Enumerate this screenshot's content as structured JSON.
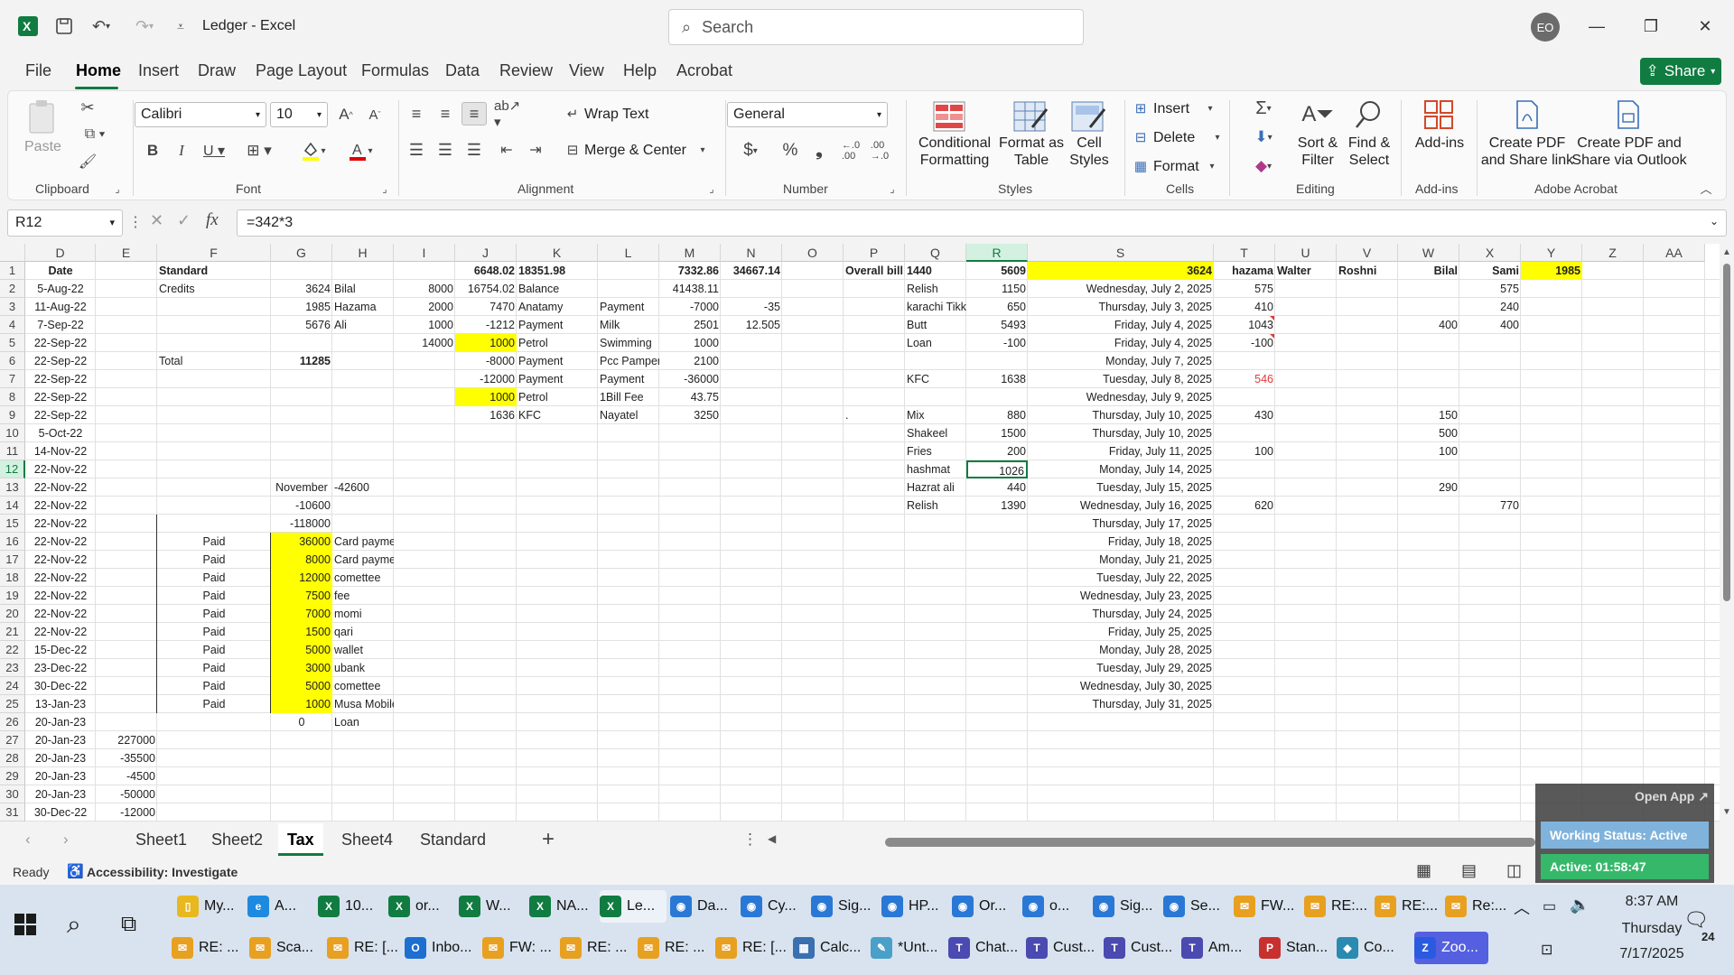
{
  "app": {
    "doc_title": "Ledger  -  Excel",
    "search_placeholder": "Search",
    "avatar_initials": "EO",
    "share_label": "Share"
  },
  "menu": [
    "File",
    "Home",
    "Insert",
    "Draw",
    "Page Layout",
    "Formulas",
    "Data",
    "Review",
    "View",
    "Help",
    "Acrobat"
  ],
  "ribbon": {
    "paste": "Paste",
    "clipboard": "Clipboard",
    "font_name": "Calibri",
    "font_size": "10",
    "font": "Font",
    "wrap_text": "Wrap Text",
    "merge_center": "Merge & Center",
    "alignment": "Alignment",
    "number_format": "General",
    "number": "Number",
    "conditional_formatting": "Conditional Formatting",
    "format_as_table": "Format as Table",
    "cell_styles": "Cell Styles",
    "styles": "Styles",
    "insert": "Insert",
    "delete": "Delete",
    "format": "Format",
    "cells": "Cells",
    "sort_filter": "Sort & Filter",
    "find_select": "Find & Select",
    "editing": "Editing",
    "add_ins": "Add-ins",
    "add_ins_group": "Add-ins",
    "create_pdf_link": "Create PDF and Share link",
    "create_pdf_outlook": "Create PDF and Share via Outlook",
    "adobe_acrobat": "Adobe Acrobat"
  },
  "formula": {
    "namebox": "R12",
    "content": "=342*3"
  },
  "columns": [
    "D",
    "E",
    "F",
    "G",
    "H",
    "I",
    "J",
    "K",
    "L",
    "M",
    "N",
    "O",
    "P",
    "Q",
    "R",
    "S",
    "T",
    "U",
    "V",
    "W",
    "X",
    "Y",
    "Z",
    "AA"
  ],
  "rows": [
    "1",
    "2",
    "3",
    "4",
    "5",
    "6",
    "7",
    "8",
    "9",
    "10",
    "11",
    "12",
    "13",
    "14",
    "15",
    "16",
    "17",
    "18",
    "19",
    "20",
    "21",
    "22",
    "23",
    "24",
    "25",
    "26",
    "27",
    "28",
    "29",
    "30",
    "31"
  ],
  "cells": {
    "D": [
      "Date",
      "5-Aug-22",
      "11-Aug-22",
      "7-Sep-22",
      "22-Sep-22",
      "22-Sep-22",
      "22-Sep-22",
      "22-Sep-22",
      "22-Sep-22",
      "5-Oct-22",
      "14-Nov-22",
      "22-Nov-22",
      "22-Nov-22",
      "22-Nov-22",
      "22-Nov-22",
      "22-Nov-22",
      "22-Nov-22",
      "22-Nov-22",
      "22-Nov-22",
      "22-Nov-22",
      "22-Nov-22",
      "15-Dec-22",
      "23-Dec-22",
      "30-Dec-22",
      "13-Jan-23",
      "20-Jan-23",
      "20-Jan-23",
      "20-Jan-23",
      "20-Jan-23",
      "20-Jan-23",
      "30-Dec-22"
    ],
    "E": {
      "27": "227000",
      "28": "-35500",
      "29": "-4500",
      "30": "-50000",
      "31": "-12000"
    },
    "F": {
      "1": "Standard",
      "2": "Credits",
      "6": "Total",
      "16": "Paid",
      "17": "Paid",
      "18": "Paid",
      "19": "Paid",
      "20": "Paid",
      "21": "Paid",
      "22": "Paid",
      "23": "Paid",
      "24": "Paid",
      "25": "Paid"
    },
    "G": {
      "2": "3624",
      "3": "1985",
      "4": "5676",
      "6": "11285",
      "13": "November",
      "14": "-10600",
      "15": "-118000",
      "16": "36000",
      "17": "8000",
      "18": "12000",
      "19": "7500",
      "20": "7000",
      "21": "1500",
      "22": "5000",
      "23": "3000",
      "24": "5000",
      "25": "1000",
      "26": "0"
    },
    "H": {
      "2": "Bilal",
      "3": "Hazama",
      "4": "Ali",
      "13": "-42600",
      "16": "Card payment",
      "17": "Card payment 2",
      "18": "comettee",
      "19": "fee",
      "20": "momi",
      "21": "qari",
      "22": "wallet",
      "23": "ubank",
      "24": "comettee",
      "25": "Musa Mobile",
      "26": "Loan"
    },
    "I": {
      "2": "8000",
      "3": "2000",
      "4": "1000",
      "5": "14000"
    },
    "J": {
      "1": "6648.02",
      "2": "16754.02",
      "3": "7470",
      "4": "-1212",
      "5": "1000",
      "6": "-8000",
      "7": "-12000",
      "8": "1000",
      "9": "1636"
    },
    "K": {
      "1": "18351.98",
      "2": "Balance",
      "3": "Anatamy",
      "4": "Payment",
      "5": "Petrol",
      "6": "Payment",
      "7": "Payment",
      "8": "Petrol",
      "9": "KFC"
    },
    "L": {
      "3": "Payment",
      "4": "Milk",
      "5": "Swimming",
      "6": "Pcc Pamper",
      "7": "Payment",
      "8": "1Bill Fee",
      "9": "Nayatel"
    },
    "M": {
      "1": "7332.86",
      "2": "41438.11",
      "3": "-7000",
      "4": "2501",
      "5": "1000",
      "6": "2100",
      "7": "-36000",
      "8": "43.75",
      "9": "3250"
    },
    "N": {
      "1": "34667.14",
      "3": "-35",
      "4": "12.505"
    },
    "P": {
      "1": "Overall bill",
      "9": "."
    },
    "Q": {
      "1": "1440",
      "2": "Relish",
      "3": "karachi Tikka",
      "4": "Butt",
      "5": "Loan",
      "7": "KFC",
      "9": "Mix",
      "10": "Shakeel",
      "11": "Fries",
      "12": "hashmat",
      "13": "Hazrat ali",
      "14": "Relish"
    },
    "R": {
      "1": "5609",
      "2": "1150",
      "3": "650",
      "4": "5493",
      "5": "-100",
      "7": "1638",
      "9": "880",
      "10": "1500",
      "11": "200",
      "12": "1026",
      "13": "440",
      "14": "1390"
    },
    "S": {
      "1": "3624",
      "2": "Wednesday, July 2, 2025",
      "3": "Thursday, July 3, 2025",
      "4": "Friday, July 4, 2025",
      "5": "Friday, July 4, 2025",
      "6": "Monday, July 7, 2025",
      "7": "Tuesday, July 8, 2025",
      "8": "Wednesday, July 9, 2025",
      "9": "Thursday, July 10, 2025",
      "10": "Thursday, July 10, 2025",
      "11": "Friday, July 11, 2025",
      "12": "Monday, July 14, 2025",
      "13": "Tuesday, July 15, 2025",
      "14": "Wednesday, July 16, 2025",
      "15": "Thursday, July 17, 2025",
      "16": "Friday, July 18, 2025",
      "17": "Monday, July 21, 2025",
      "18": "Tuesday, July 22, 2025",
      "19": "Wednesday, July 23, 2025",
      "20": "Thursday, July 24, 2025",
      "21": "Friday, July 25, 2025",
      "22": "Monday, July 28, 2025",
      "23": "Tuesday, July 29, 2025",
      "24": "Wednesday, July 30, 2025",
      "25": "Thursday, July 31, 2025"
    },
    "T": {
      "1": "hazama",
      "2": "575",
      "3": "410",
      "4": "1043",
      "5": "-100",
      "7": "546",
      "9": "430",
      "11": "100",
      "14": "620"
    },
    "U": {
      "1": "Walter"
    },
    "V": {
      "1": "Roshni"
    },
    "W": {
      "1": "Bilal",
      "4": "400",
      "9": "150",
      "10": "500",
      "11": "100",
      "13": "290"
    },
    "X": {
      "1": "Sami",
      "2": "575",
      "3": "240",
      "4": "400",
      "14": "770"
    },
    "Y": {
      "1": "1985"
    }
  },
  "sheets": [
    "Sheet1",
    "Sheet2",
    "Tax",
    "Sheet4",
    "Standard"
  ],
  "status": {
    "ready": "Ready",
    "accessibility": "Accessibility: Investigate"
  },
  "overlay": {
    "open_app": "Open App ↗",
    "working_status": "Working Status: Active",
    "active_time": "Active: 01:58:47"
  },
  "taskbar": {
    "row1": [
      "My...",
      "A...",
      "10...",
      "or...",
      "W...",
      "NA...",
      "Le...",
      "Da...",
      "Cy...",
      "Sig...",
      "HP...",
      "Or...",
      "o...",
      "Sig...",
      "Se...",
      "FW...",
      "RE:...",
      "RE:...",
      "Re:..."
    ],
    "row2": [
      "RE: ...",
      "Sca...",
      "RE: [...",
      "Inbo...",
      "FW: ...",
      "RE: ...",
      "RE: ...",
      "RE: [...",
      "Calc...",
      "*Unt...",
      "Chat...",
      "Cust...",
      "Cust...",
      "Am...",
      "Stan...",
      "Co...",
      "Zoo..."
    ],
    "time": "8:37 AM",
    "day": "Thursday",
    "date": "7/17/2025",
    "notifications": "24"
  }
}
